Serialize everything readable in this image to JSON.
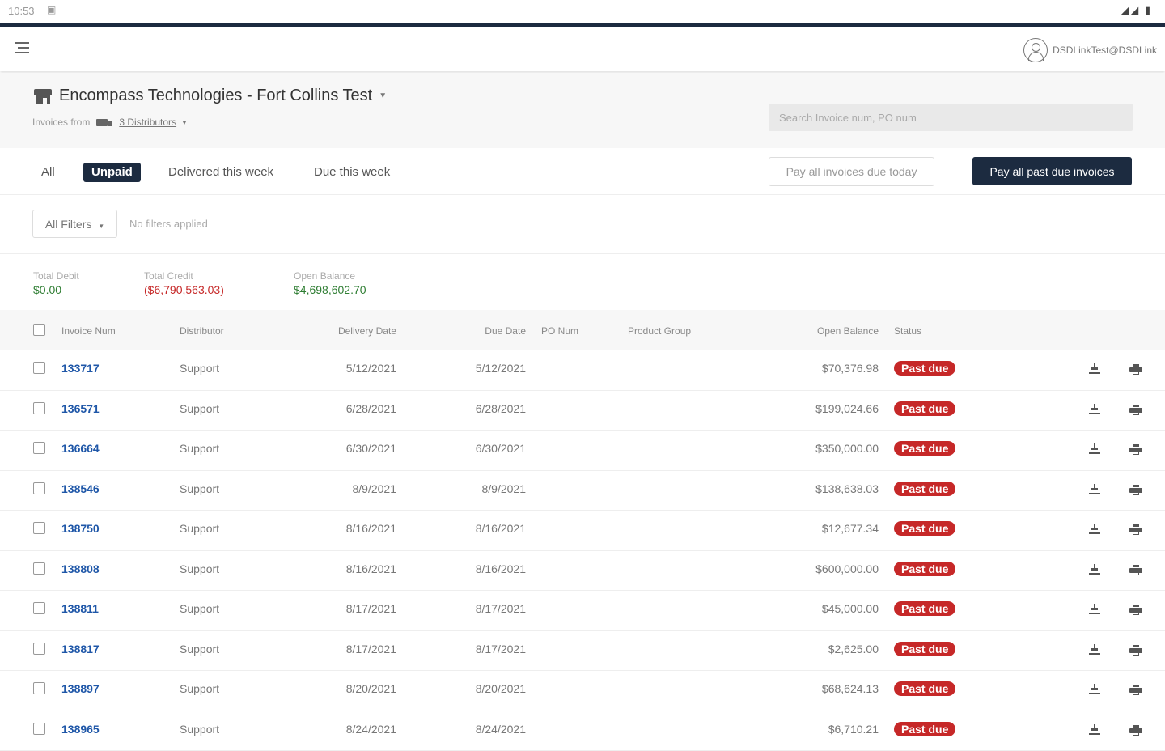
{
  "statusbar": {
    "time": "10:53",
    "sim_icon": "sim-icon",
    "right_icons": "◢◢ ▮"
  },
  "appbar": {
    "user_email": "DSDLinkTest@DSDLink"
  },
  "header": {
    "company": "Encompass Technologies - Fort Collins Test",
    "invoices_from": "Invoices from",
    "distributors": "3 Distributors",
    "search_placeholder": "Search Invoice num, PO num"
  },
  "tabs": {
    "all": "All",
    "unpaid": "Unpaid",
    "delivered_week": "Delivered this week",
    "due_week": "Due this week",
    "pay_today": "Pay all invoices due today",
    "pay_past_due": "Pay all past due invoices"
  },
  "filters": {
    "all_filters": "All Filters",
    "no_filters": "No filters applied"
  },
  "totals": {
    "debit_label": "Total Debit",
    "debit_value": "$0.00",
    "credit_label": "Total Credit",
    "credit_value": "($6,790,563.03)",
    "open_label": "Open Balance",
    "open_value": "$4,698,602.70"
  },
  "table": {
    "columns": {
      "invoice": "Invoice Num",
      "distributor": "Distributor",
      "delivery": "Delivery Date",
      "due": "Due Date",
      "po": "PO Num",
      "product": "Product Group",
      "balance": "Open Balance",
      "status": "Status"
    },
    "rows": [
      {
        "invoice": "133717",
        "distributor": "Support",
        "delivery": "5/12/2021",
        "due": "5/12/2021",
        "balance": "$70,376.98",
        "status": "Past due"
      },
      {
        "invoice": "136571",
        "distributor": "Support",
        "delivery": "6/28/2021",
        "due": "6/28/2021",
        "balance": "$199,024.66",
        "status": "Past due"
      },
      {
        "invoice": "136664",
        "distributor": "Support",
        "delivery": "6/30/2021",
        "due": "6/30/2021",
        "balance": "$350,000.00",
        "status": "Past due"
      },
      {
        "invoice": "138546",
        "distributor": "Support",
        "delivery": "8/9/2021",
        "due": "8/9/2021",
        "balance": "$138,638.03",
        "status": "Past due"
      },
      {
        "invoice": "138750",
        "distributor": "Support",
        "delivery": "8/16/2021",
        "due": "8/16/2021",
        "balance": "$12,677.34",
        "status": "Past due"
      },
      {
        "invoice": "138808",
        "distributor": "Support",
        "delivery": "8/16/2021",
        "due": "8/16/2021",
        "balance": "$600,000.00",
        "status": "Past due"
      },
      {
        "invoice": "138811",
        "distributor": "Support",
        "delivery": "8/17/2021",
        "due": "8/17/2021",
        "balance": "$45,000.00",
        "status": "Past due"
      },
      {
        "invoice": "138817",
        "distributor": "Support",
        "delivery": "8/17/2021",
        "due": "8/17/2021",
        "balance": "$2,625.00",
        "status": "Past due"
      },
      {
        "invoice": "138897",
        "distributor": "Support",
        "delivery": "8/20/2021",
        "due": "8/20/2021",
        "balance": "$68,624.13",
        "status": "Past due"
      },
      {
        "invoice": "138965",
        "distributor": "Support",
        "delivery": "8/24/2021",
        "due": "8/24/2021",
        "balance": "$6,710.21",
        "status": "Past due"
      }
    ]
  },
  "colors": {
    "navy": "#1c2b40",
    "past_due": "#c62828",
    "link": "#1f57a8",
    "positive": "#2e7d32"
  }
}
